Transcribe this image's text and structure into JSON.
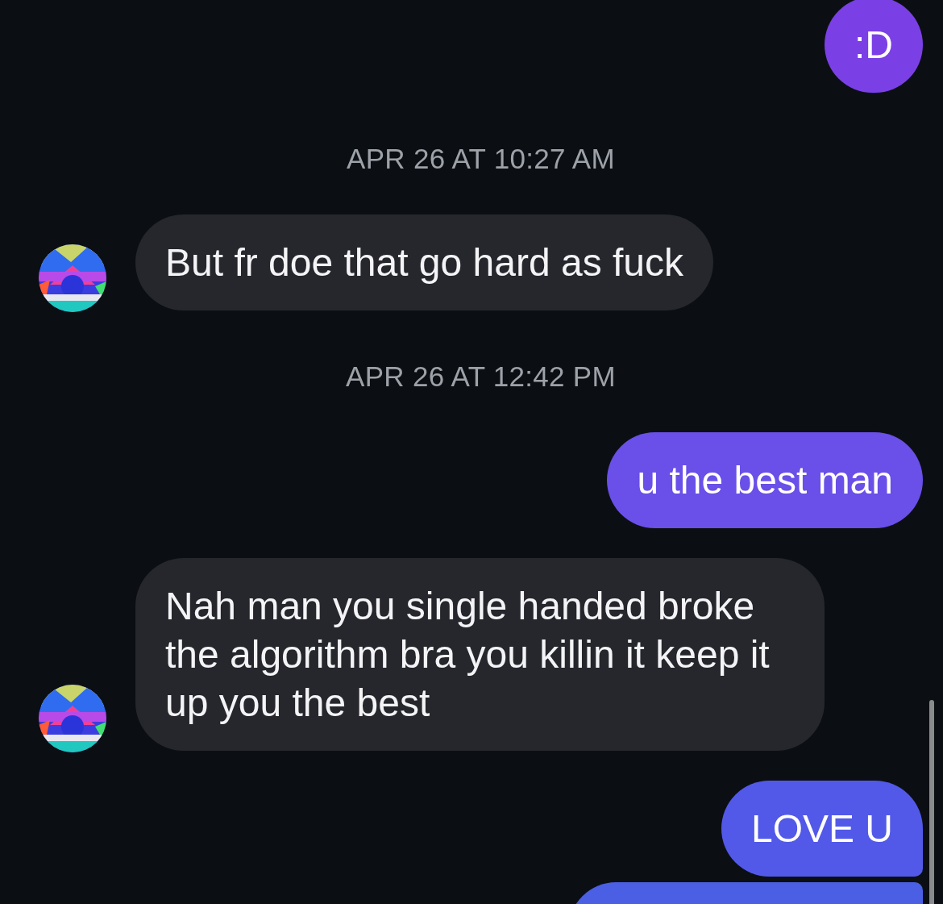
{
  "messages": [
    {
      "kind": "outgoing",
      "text": ":D",
      "color": "#7b3fe6"
    },
    {
      "kind": "timestamp",
      "text": "APR 26 AT 10:27 AM"
    },
    {
      "kind": "incoming",
      "text": "But fr doe that go hard as fuck"
    },
    {
      "kind": "timestamp",
      "text": "APR 26 AT 12:42 PM"
    },
    {
      "kind": "outgoing",
      "text": "u the best man",
      "color": "#6a4fe8"
    },
    {
      "kind": "incoming",
      "text": "Nah man you single handed broke the algorithm bra you killin it keep it up you the best"
    },
    {
      "kind": "outgoing",
      "text": "LOVE U",
      "color": "#5259e8"
    },
    {
      "kind": "outgoing",
      "color": "#4a5fe4"
    }
  ]
}
